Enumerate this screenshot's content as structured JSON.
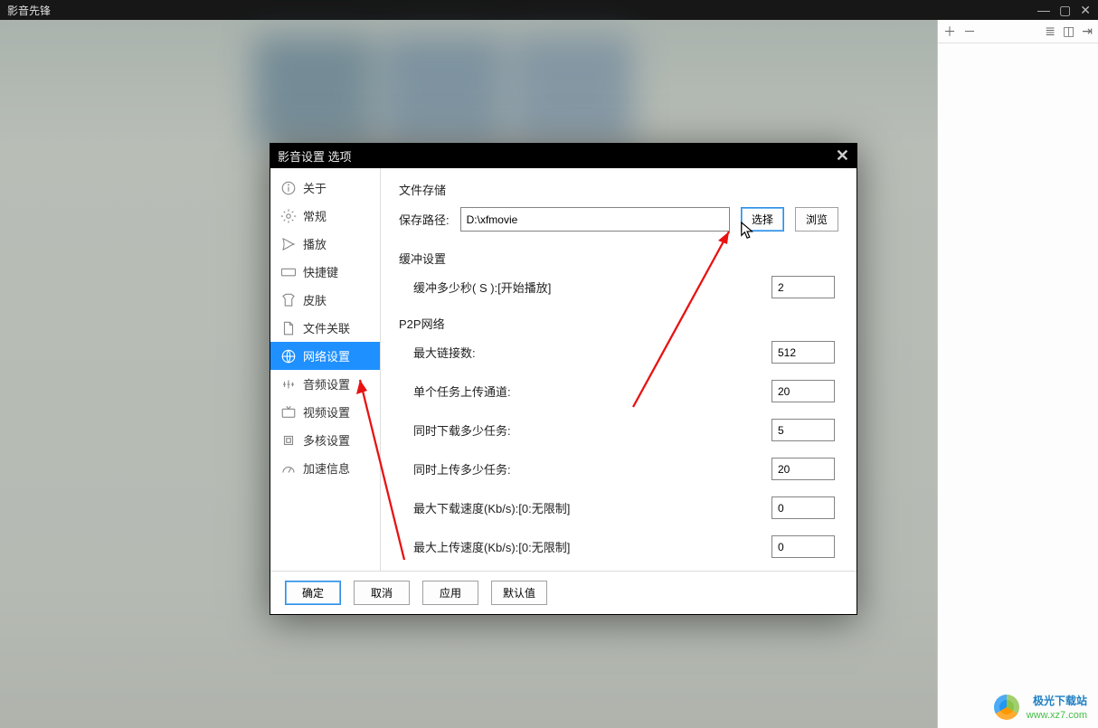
{
  "app": {
    "title": "影音先锋"
  },
  "dialog": {
    "title": "影音设置 选项",
    "nav": {
      "about": "关于",
      "general": "常规",
      "playback": "播放",
      "hotkey": "快捷键",
      "skin": "皮肤",
      "fileassoc": "文件关联",
      "network": "网络设置",
      "audio": "音频设置",
      "video": "视频设置",
      "multicore": "多核设置",
      "accel": "加速信息"
    },
    "storage": {
      "section": "文件存储",
      "pathLabel": "保存路径:",
      "pathValue": "D:\\xfmovie",
      "selectBtn": "选择",
      "browseBtn": "浏览"
    },
    "buffer": {
      "section": "缓冲设置",
      "secLabel": "缓冲多少秒( S ):[开始播放]",
      "secValue": "2"
    },
    "p2p": {
      "section": "P2P网络",
      "maxConnLabel": "最大链接数:",
      "maxConnValue": "512",
      "upChanLabel": "单个任务上传通道:",
      "upChanValue": "20",
      "dlTaskLabel": "同时下载多少任务:",
      "dlTaskValue": "5",
      "ulTaskLabel": "同时上传多少任务:",
      "ulTaskValue": "20",
      "maxDlLabel": "最大下载速度(Kb/s):[0:无限制]",
      "maxDlValue": "0",
      "maxUlLabel": "最大上传速度(Kb/s):[0:无限制]",
      "maxUlValue": "0"
    },
    "footer": {
      "ok": "确定",
      "cancel": "取消",
      "apply": "应用",
      "default": "默认值"
    }
  },
  "watermark": {
    "line1": "极光下载站",
    "line2": "www.xz7.com"
  }
}
